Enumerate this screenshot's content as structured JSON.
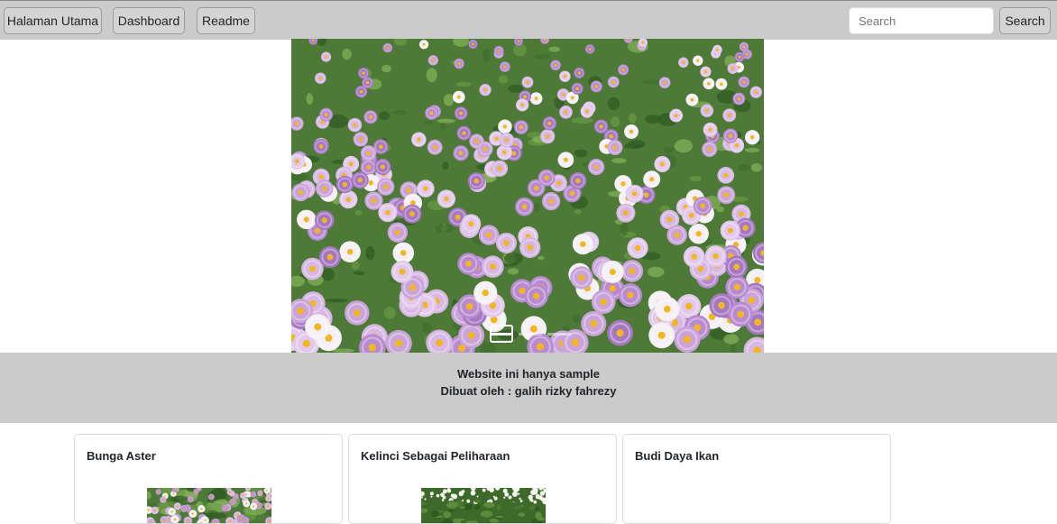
{
  "nav": {
    "items": [
      {
        "label": "Halaman Utama"
      },
      {
        "label": "Dashboard"
      },
      {
        "label": "Readme"
      }
    ],
    "search": {
      "placeholder": "Search",
      "value": "",
      "button_label": "Search"
    }
  },
  "carousel": {
    "image_icon": "flower-field-image",
    "slide_count": 3,
    "active_slide": 1
  },
  "footer": {
    "line1": "Website ini hanya sample",
    "line2": "Dibuat oleh : galih rizky fahrezy"
  },
  "cards": [
    {
      "title": "Bunga Aster",
      "image_icon": "aster-flowers-thumbnail"
    },
    {
      "title": "Kelinci Sebagai Peliharaan",
      "image_icon": "rabbit-meadow-thumbnail"
    },
    {
      "title": "Budi Daya Ikan",
      "image_icon": ""
    }
  ],
  "colors": {
    "bar_background": "#cbcbcb",
    "button_background": "#d4d4d4",
    "text": "#212529"
  }
}
